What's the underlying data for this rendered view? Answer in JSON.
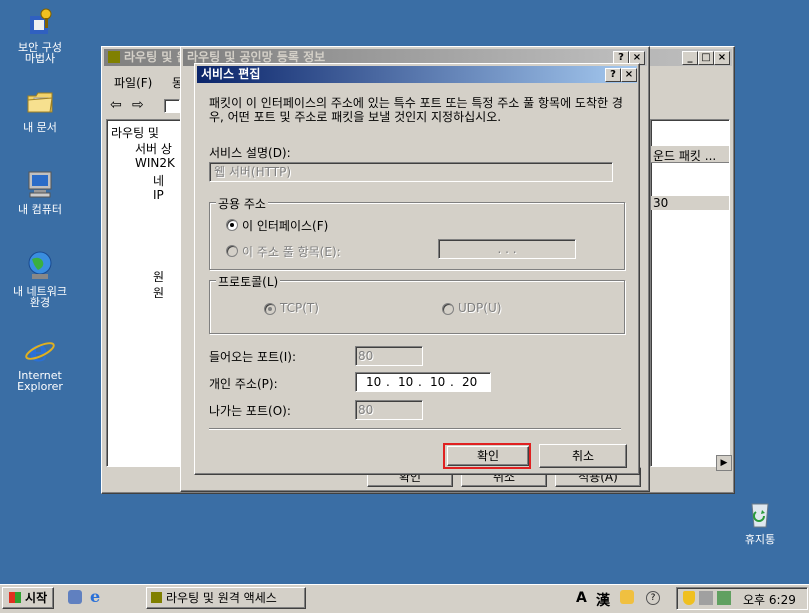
{
  "desktop": {
    "icons": [
      {
        "label_line1": "보안 구성",
        "label_line2": "마법사"
      },
      {
        "label_line1": "내 문서",
        "label_line2": ""
      },
      {
        "label_line1": "내 컴퓨터",
        "label_line2": ""
      },
      {
        "label_line1": "내 네트워크",
        "label_line2": "환경"
      },
      {
        "label_line1": "Internet",
        "label_line2": "Explorer"
      },
      {
        "label_line1": "휴지통",
        "label_line2": ""
      }
    ]
  },
  "bg_window": {
    "title": "라우팅 및 원격 액세스",
    "menu": [
      "파일(F)",
      "동"
    ],
    "tree": [
      "라우팅 및",
      "서버 상",
      "WIN2K",
      "네",
      "IP",
      "원",
      "원"
    ],
    "right_header": "운드 패킷 ...",
    "right_value": "30",
    "buttons": [
      "확인",
      "취소",
      "적용(A)"
    ]
  },
  "props_window": {
    "title": "라우팅 및 공인망 등록 정보"
  },
  "dialog": {
    "title": "서비스 편집",
    "help_btn": "?",
    "close_btn": "×",
    "description": "패킷이 이 인터페이스의 주소에 있는 특수 포트 또는 특정 주소 풀 항목에 도착한 경우, 어떤 포트 및 주소로 패킷을 보낼 것인지 지정하십시오.",
    "service_desc_label": "서비스 설명(D):",
    "service_desc_value": "웹 서버(HTTP)",
    "public_address_group": "공용 주소",
    "radio_interface": "이 인터페이스(F)",
    "radio_pool": "이 주소 풀 항목(E):",
    "pool_value": ". . .",
    "protocol_group": "프로토콜(L)",
    "radio_tcp": "TCP(T)",
    "radio_udp": "UDP(U)",
    "incoming_port_label": "들어오는 포트(I):",
    "incoming_port_value": "80",
    "private_address_label": "개인 주소(P):",
    "private_address": [
      "10",
      "10",
      "10",
      "20"
    ],
    "outgoing_port_label": "나가는 포트(O):",
    "outgoing_port_value": "80",
    "ok_label": "확인",
    "cancel_label": "취소"
  },
  "taskbar": {
    "start_label": "시작",
    "task_label": "라우팅 및 원격 액세스",
    "lang_a": "A",
    "lang_han": "漢",
    "clock": "오후 6:29"
  }
}
